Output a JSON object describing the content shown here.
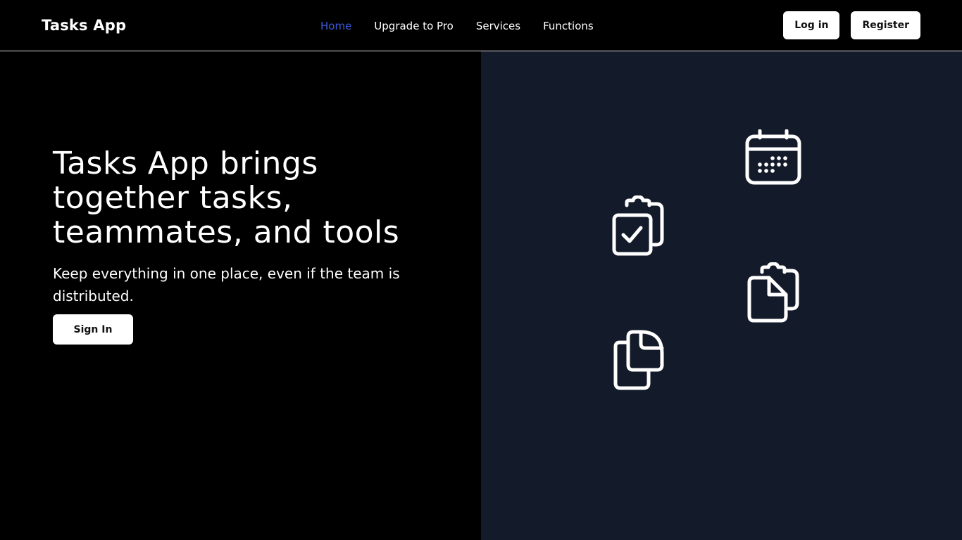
{
  "navbar": {
    "brand": "Tasks App",
    "links": [
      {
        "label": "Home",
        "active": true
      },
      {
        "label": "Upgrade to Pro"
      },
      {
        "label": "Services"
      },
      {
        "label": "Functions"
      }
    ],
    "login_label": "Log in",
    "register_label": "Register"
  },
  "hero": {
    "title": "Tasks App brings together tasks, teammates, and tools",
    "subtitle": "Keep everything in one place, even if the team is distributed.",
    "signin_label": "Sign In"
  },
  "icons": [
    "calendar-icon",
    "clipboard-check-icon",
    "clipboard-copy-icon",
    "documents-icon"
  ],
  "colors": {
    "active_link": "#3b5bdb",
    "right_panel_bg": "#131a29",
    "navbar_bg": "#000000"
  }
}
